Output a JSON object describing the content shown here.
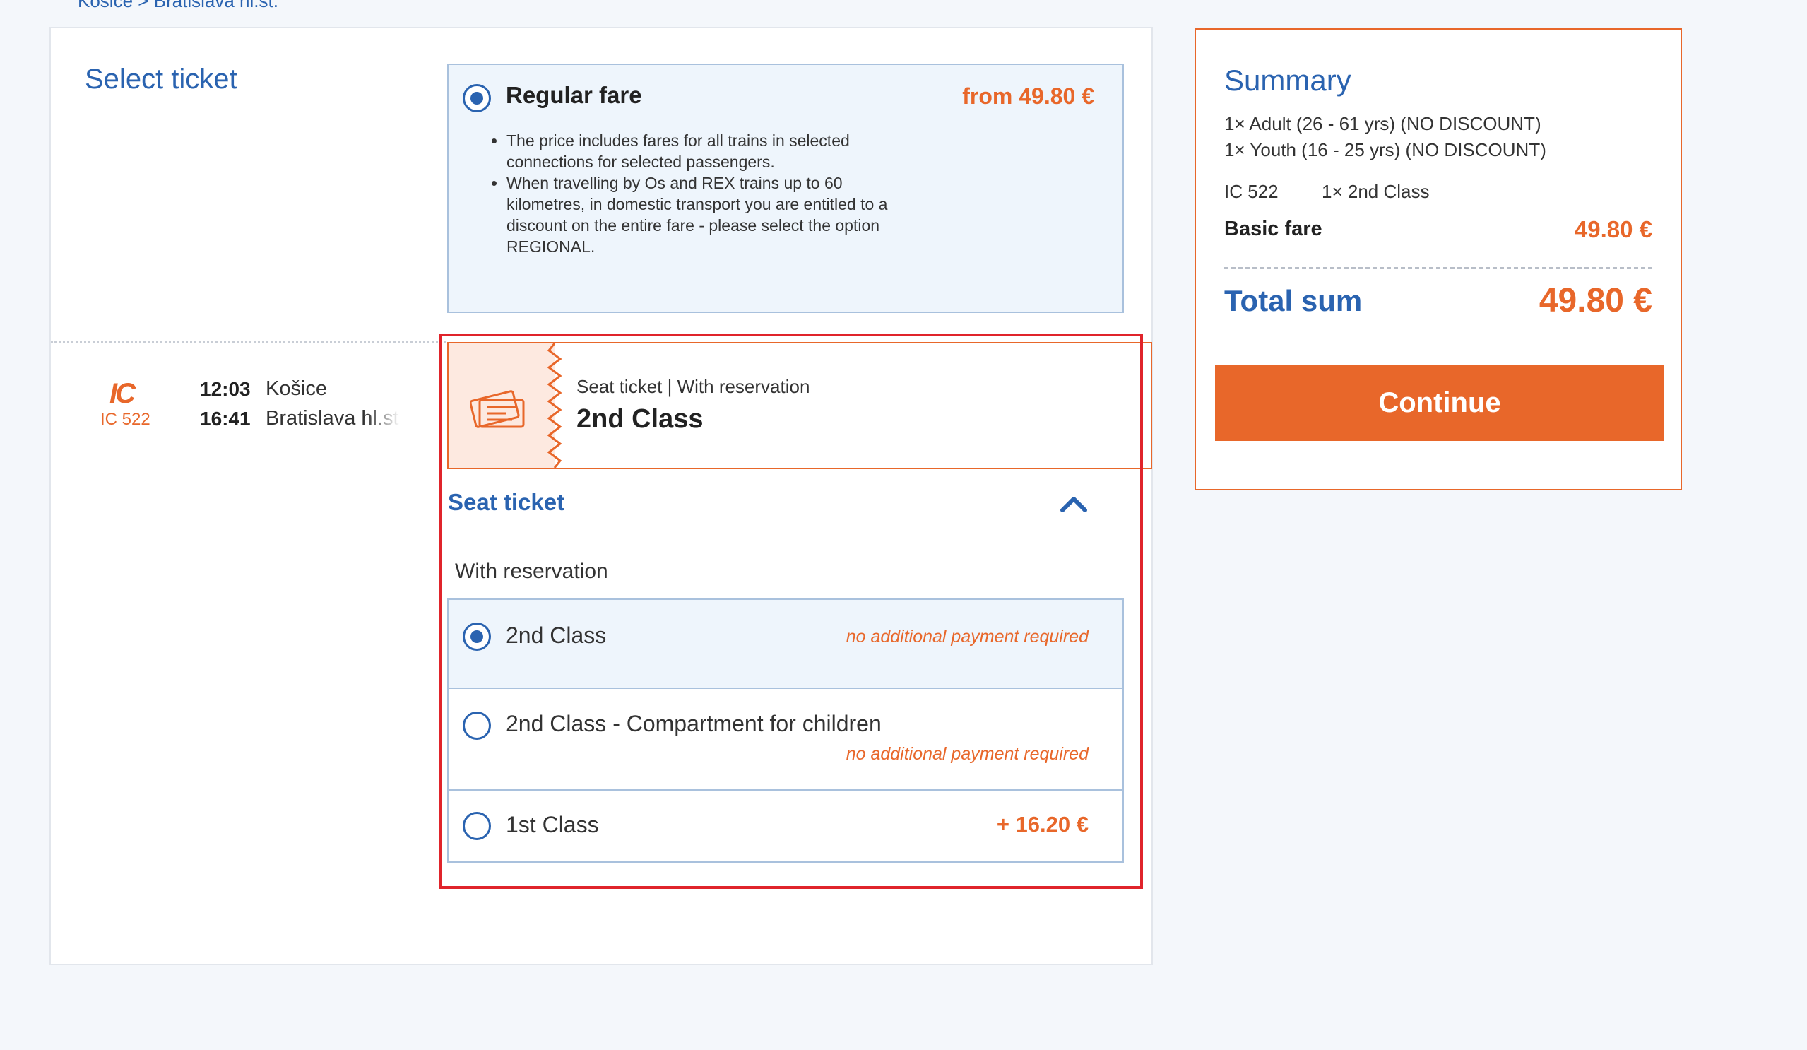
{
  "breadcrumb": "Košice > Bratislava hl.st.",
  "select_ticket": {
    "title": "Select ticket"
  },
  "fare": {
    "name": "Regular fare",
    "price": "from 49.80 €",
    "notes": [
      "The price includes fares for all trains in selected connections for selected passengers.",
      "When travelling by Os and REX trains up to 60 kilometres, in domestic transport you are entitled to a discount on the entire fare - please select the option REGIONAL."
    ]
  },
  "connection": {
    "train_logo": "IC",
    "train_number": "IC 522",
    "departure_time": "12:03",
    "departure_station": "Košice",
    "arrival_time": "16:41",
    "arrival_station": "Bratislava hl.st."
  },
  "ticket": {
    "subtitle": "Seat ticket | With reservation",
    "class": "2nd Class",
    "section_label": "Seat ticket",
    "group_label": "With reservation",
    "options": [
      {
        "label": "2nd Class",
        "note": "no additional payment required",
        "selected": true
      },
      {
        "label": "2nd Class - Compartment for children",
        "note": "no additional payment required",
        "selected": false
      },
      {
        "label": "1st Class",
        "price": "+ 16.20 €",
        "selected": false
      }
    ]
  },
  "summary": {
    "title": "Summary",
    "passengers": [
      "1× Adult (26 - 61 yrs) (NO DISCOUNT)",
      "1× Youth (16 - 25 yrs) (NO DISCOUNT)"
    ],
    "train": "IC 522",
    "class": "1× 2nd Class",
    "basic_fare_label": "Basic fare",
    "basic_fare_value": "49.80 €",
    "total_label": "Total sum",
    "total_value": "49.80 €",
    "continue_label": "Continue"
  },
  "colors": {
    "brand_blue": "#2a63b0",
    "accent_orange": "#e8672a",
    "highlight_red": "#e0242b"
  },
  "icons": {
    "ticket": "ticket-icon",
    "collapse": "chevron-up-icon",
    "train_logo": "ic-logo"
  }
}
